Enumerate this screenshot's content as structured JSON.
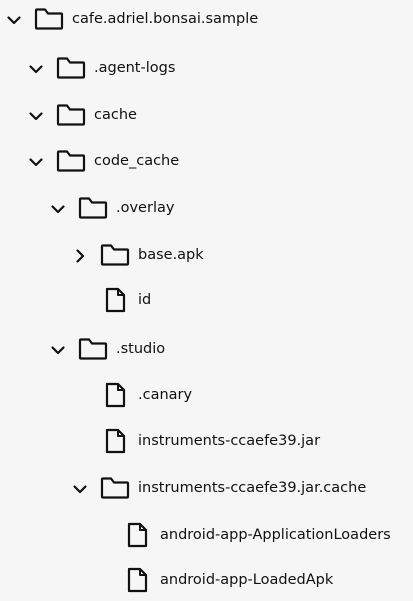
{
  "tree": {
    "rows": [
      {
        "label": "cafe.adriel.bonsai.sample",
        "type": "folder",
        "state": "expanded",
        "depth": 0,
        "icon": "folder-icon",
        "chevron": "chevron-down-icon"
      },
      {
        "label": ".agent-logs",
        "type": "folder",
        "state": "expanded",
        "depth": 1,
        "icon": "folder-icon",
        "chevron": "chevron-down-icon"
      },
      {
        "label": "cache",
        "type": "folder",
        "state": "expanded",
        "depth": 1,
        "icon": "folder-icon",
        "chevron": "chevron-down-icon"
      },
      {
        "label": "code_cache",
        "type": "folder",
        "state": "expanded",
        "depth": 1,
        "icon": "folder-icon",
        "chevron": "chevron-down-icon"
      },
      {
        "label": ".overlay",
        "type": "folder",
        "state": "expanded",
        "depth": 2,
        "icon": "folder-icon",
        "chevron": "chevron-down-icon"
      },
      {
        "label": "base.apk",
        "type": "folder",
        "state": "collapsed",
        "depth": 3,
        "icon": "folder-icon",
        "chevron": "chevron-right-icon"
      },
      {
        "label": "id",
        "type": "file",
        "state": "leaf",
        "depth": 3,
        "icon": "file-icon",
        "chevron": ""
      },
      {
        "label": ".studio",
        "type": "folder",
        "state": "expanded",
        "depth": 2,
        "icon": "folder-icon",
        "chevron": "chevron-down-icon"
      },
      {
        "label": ".canary",
        "type": "file",
        "state": "leaf",
        "depth": 3,
        "icon": "file-icon",
        "chevron": ""
      },
      {
        "label": "instruments-ccaefe39.jar",
        "type": "file",
        "state": "leaf",
        "depth": 3,
        "icon": "file-icon",
        "chevron": ""
      },
      {
        "label": "instruments-ccaefe39.jar.cache",
        "type": "folder",
        "state": "expanded",
        "depth": 3,
        "icon": "folder-icon",
        "chevron": "chevron-down-icon"
      },
      {
        "label": "android-app-ApplicationLoaders",
        "type": "file",
        "state": "leaf",
        "depth": 4,
        "icon": "file-icon",
        "chevron": ""
      },
      {
        "label": "android-app-LoadedApk",
        "type": "file",
        "state": "leaf",
        "depth": 4,
        "icon": "file-icon",
        "chevron": ""
      }
    ]
  }
}
